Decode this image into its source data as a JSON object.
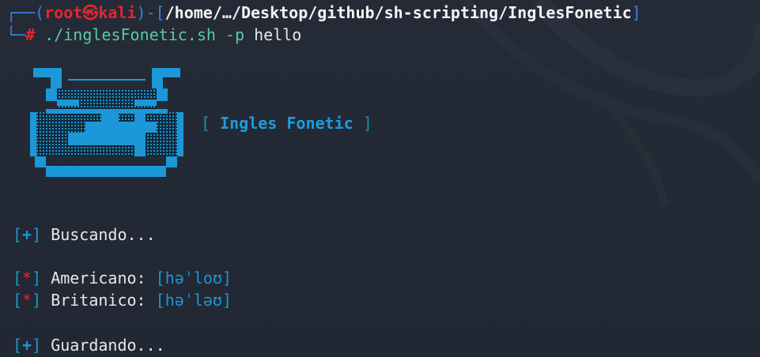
{
  "prompt": {
    "user": "root",
    "skull_glyph": "㉿",
    "host": "kali",
    "path": "/home/…/Desktop/github/sh-scripting/InglesFonetic",
    "symbol": "#",
    "command": "./inglesFonetic.sh",
    "flag": "-p",
    "argument": "hello"
  },
  "banner": {
    "title_open": "[",
    "title": "Ingles Fonetic",
    "title_close": "]"
  },
  "output": [
    {
      "marker": "+",
      "text": "Buscando..."
    },
    {
      "marker": "*",
      "label": "Americano:",
      "value": "[həˈloʊ]"
    },
    {
      "marker": "*",
      "label": "Britanico:",
      "value": "[həˈləʊ]"
    },
    {
      "marker": "+",
      "text": "Guardando..."
    }
  ],
  "colors": {
    "background": "#222833",
    "accent_blue": "#1c97d8",
    "root_red": "#e3262f",
    "prompt_blue": "#3f7fdc"
  }
}
